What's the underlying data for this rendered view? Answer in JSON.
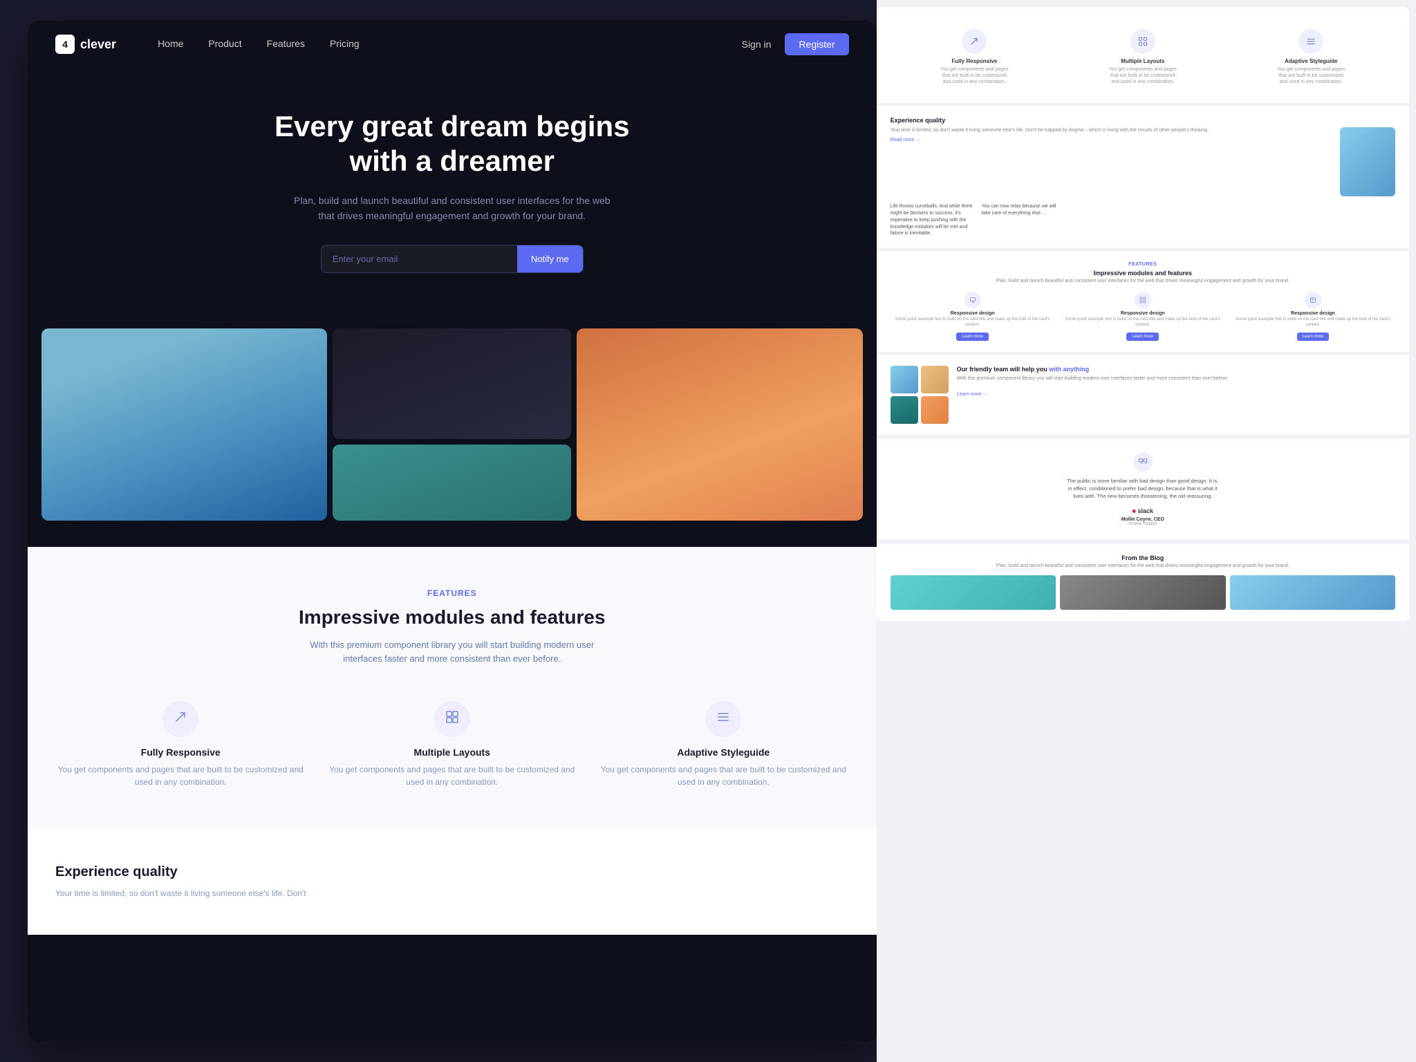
{
  "brand": {
    "name": "clever",
    "logo_char": "4"
  },
  "navbar": {
    "links": [
      "Home",
      "Product",
      "Features",
      "Pricing"
    ],
    "sign_in": "Sign in",
    "register": "Register"
  },
  "hero": {
    "heading_line1": "Every great dream begins",
    "heading_line2": "with a dreamer",
    "description": "Plan, build and launch beautiful and consistent user interfaces for the web that drives meaningful engagement and growth for your brand.",
    "email_placeholder": "Enter your email",
    "notify_btn": "Notify me"
  },
  "features_section": {
    "label": "FEATURES",
    "title": "Impressive modules and features",
    "description": "With this premium component library you will start building modern user interfaces faster and more consistent than ever before.",
    "cards": [
      {
        "icon": "↗",
        "title": "Fully Responsive",
        "description": "You get components and pages that are built to be customized and used in any combination."
      },
      {
        "icon": "⊞",
        "title": "Multiple Layouts",
        "description": "You get components and pages that are built to be customized and used in any combination."
      },
      {
        "icon": "≡",
        "title": "Adaptive Styleguide",
        "description": "You get components and pages that are built to be customized and used in any combination."
      }
    ]
  },
  "experience_section": {
    "title": "Experience quality",
    "description": "Your time is limited, so don't waste it living someone else's life. Don't"
  },
  "preview": {
    "icons_row": {
      "title1": "Fully Responsive",
      "desc1": "You get components and pages that are built to be customized and used in any combination.",
      "title2": "Multiple Layouts",
      "desc2": "You get components and pages that are built to be customized and used in any combination.",
      "title3": "Adaptive Styleguide",
      "desc3": "You get components and pages that are built to be customized and used in any combination."
    },
    "exp_quality": {
      "title": "Experience quality",
      "body": "Your time is limited, so don't waste it living someone else's life. Don't be trapped by dogma – which is living with the results of other people's thinking.",
      "read_more": "Read more →",
      "aside": "Life throws curveballs. And while there might be blockers to success, it's imperative to keep pushing with the knowledge mistakes will be met and failure is inevitable.",
      "aside2": "You can now relax because we will take care of everything else ..."
    },
    "features": {
      "label": "FEATURES",
      "title": "Impressive modules and features",
      "desc": "Plan, build and launch beautiful and consistent user interfaces for the web that drives meaningful engagement and growth for your brand.",
      "card1_name": "Responsive design",
      "card2_name": "Responsive design",
      "card3_name": "Responsive design",
      "card_desc": "Some quick example text to build on the card title and make up the bulk of the card's content.",
      "learn_more": "Learn more"
    },
    "team": {
      "title_part1": "Our friendly team will help you ",
      "title_link": "with anything",
      "desc": "With this premium component library you will start building modern user interfaces faster and more consistent than ever before.",
      "learn_more": "Learn more →"
    },
    "testimonial": {
      "quote": "The public is more familiar with bad design than good design. It is, in effect, conditioned to prefer bad design, because that is what it lives with. The new becomes threatening, the old reassuring.",
      "company": "slack",
      "author": "Mollie Coyne, CEO",
      "role": "Pname Snippet"
    },
    "blog": {
      "title": "From the Blog",
      "desc": "Plan, build and launch beautiful and consistent user interfaces for the web that drives meaningful engagement and growth for your brand."
    }
  }
}
